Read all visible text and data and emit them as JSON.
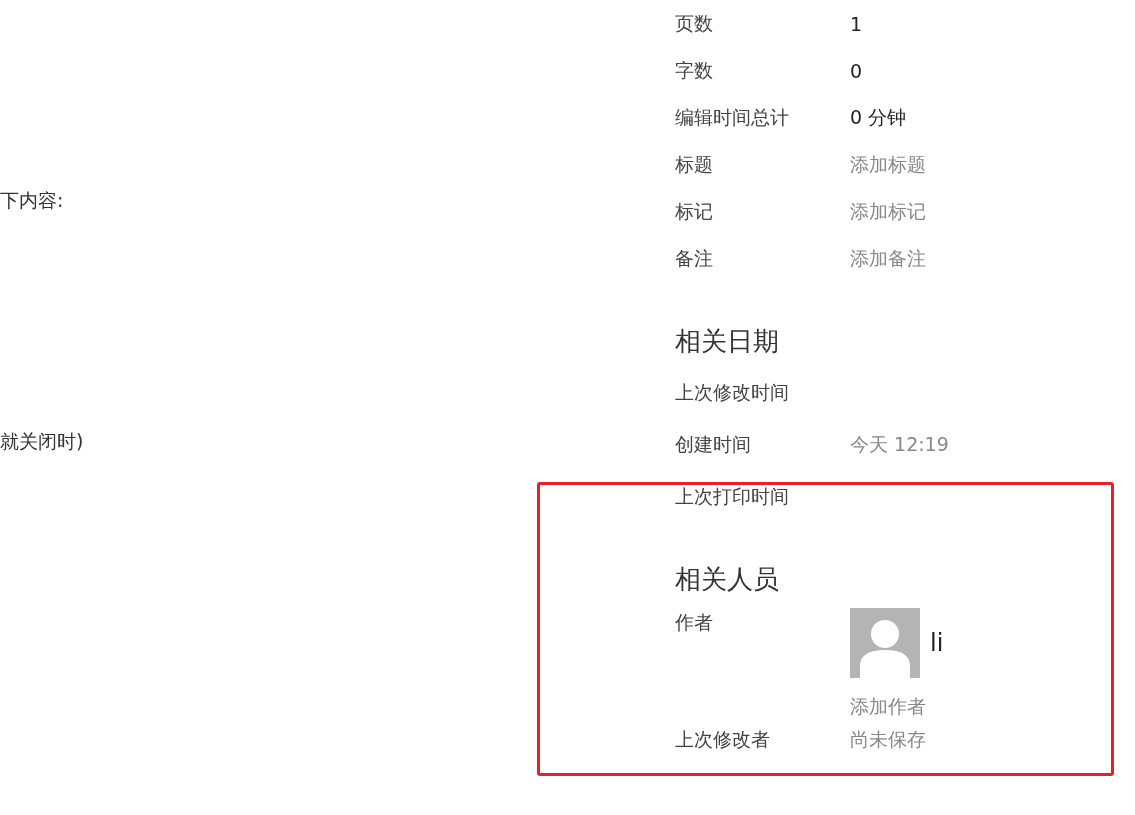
{
  "left_texts": [
    "下内容:",
    "就关闭时)"
  ],
  "properties": [
    {
      "label": "页数",
      "value": "1",
      "kind": "value"
    },
    {
      "label": "字数",
      "value": "0",
      "kind": "value"
    },
    {
      "label": "编辑时间总计",
      "value": "0 分钟",
      "kind": "value"
    },
    {
      "label": "标题",
      "value": "添加标题",
      "kind": "placeholder"
    },
    {
      "label": "标记",
      "value": "添加标记",
      "kind": "placeholder"
    },
    {
      "label": "备注",
      "value": "添加备注",
      "kind": "placeholder"
    }
  ],
  "related_dates": {
    "heading": "相关日期",
    "rows": [
      {
        "label": "上次修改时间"
      },
      {
        "label": "创建时间",
        "value": "今天 12:19"
      },
      {
        "label": "上次打印时间"
      }
    ]
  },
  "related_people": {
    "heading": "相关人员",
    "author": {
      "label": "作者",
      "name": "li",
      "add_link": "添加作者"
    },
    "last_modified_by": {
      "label": "上次修改者",
      "value": "尚未保存"
    }
  }
}
